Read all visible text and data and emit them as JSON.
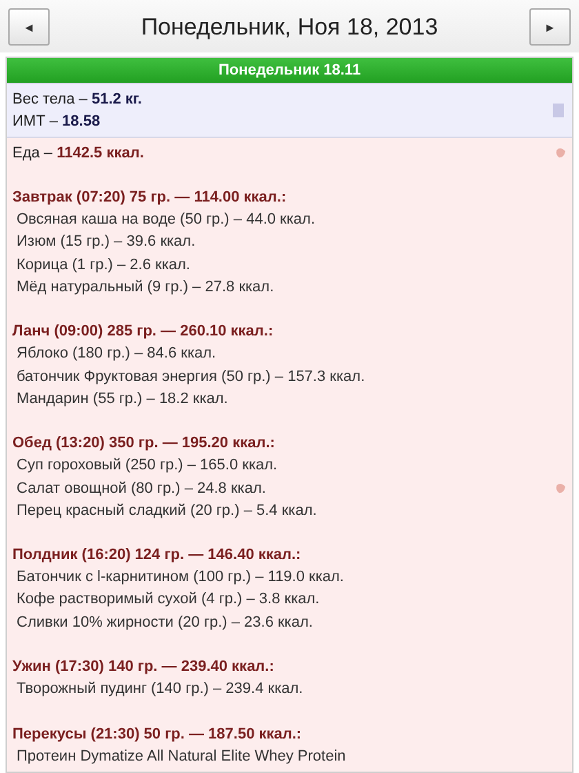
{
  "header": {
    "prev": "◄",
    "title": "Понедельник, Ноя 18, 2013",
    "next": "►"
  },
  "day_bar": "Понедельник 18.11",
  "body": {
    "weight_label": "Вес тела –",
    "weight_value": "51.2 кг.",
    "bmi_label": "ИМТ  –",
    "bmi_value": "18.58"
  },
  "food": {
    "label": "Еда –",
    "total": "1142.5 ккал.",
    "meals": [
      {
        "title": "Завтрак (07:20) 75 гр. — 114.00 ккал.:",
        "items": [
          {
            "text": "Овсяная каша на воде (50 гр.) – 44.0 ккал.",
            "marker": false
          },
          {
            "text": "Изюм (15 гр.) – 39.6 ккал.",
            "marker": false
          },
          {
            "text": "Корица (1 гр.) – 2.6 ккал.",
            "marker": false
          },
          {
            "text": "Мёд натуральный (9 гр.) – 27.8 ккал.",
            "marker": false
          }
        ]
      },
      {
        "title": "Ланч (09:00) 285 гр. — 260.10 ккал.:",
        "items": [
          {
            "text": "Яблоко (180 гр.) – 84.6 ккал.",
            "marker": false
          },
          {
            "text": "батончик Фруктовая энергия (50 гр.) – 157.3 ккал.",
            "marker": false
          },
          {
            "text": "Мандарин (55 гр.) – 18.2 ккал.",
            "marker": false
          }
        ]
      },
      {
        "title": "Обед (13:20) 350 гр. — 195.20 ккал.:",
        "items": [
          {
            "text": "Суп гороховый (250 гр.) – 165.0 ккал.",
            "marker": false
          },
          {
            "text": "Салат овощной (80 гр.) – 24.8 ккал.",
            "marker": true
          },
          {
            "text": "Перец красный сладкий (20 гр.) – 5.4 ккал.",
            "marker": false
          }
        ]
      },
      {
        "title": "Полдник (16:20) 124 гр. — 146.40 ккал.:",
        "items": [
          {
            "text": "Батончик с l-карнитином (100 гр.) – 119.0 ккал.",
            "marker": false
          },
          {
            "text": "Кофе растворимый сухой (4 гр.) – 3.8 ккал.",
            "marker": false
          },
          {
            "text": "Сливки 10% жирности (20 гр.) – 23.6 ккал.",
            "marker": false
          }
        ]
      },
      {
        "title": "Ужин (17:30) 140 гр. — 239.40 ккал.:",
        "items": [
          {
            "text": "Творожный пудинг (140 гр.) – 239.4 ккал.",
            "marker": false
          }
        ]
      },
      {
        "title": "Перекусы (21:30) 50 гр. — 187.50 ккал.:",
        "items": [
          {
            "text": "Протеин Dymatize All Natural Elite Whey Protein",
            "marker": false
          }
        ]
      }
    ]
  }
}
